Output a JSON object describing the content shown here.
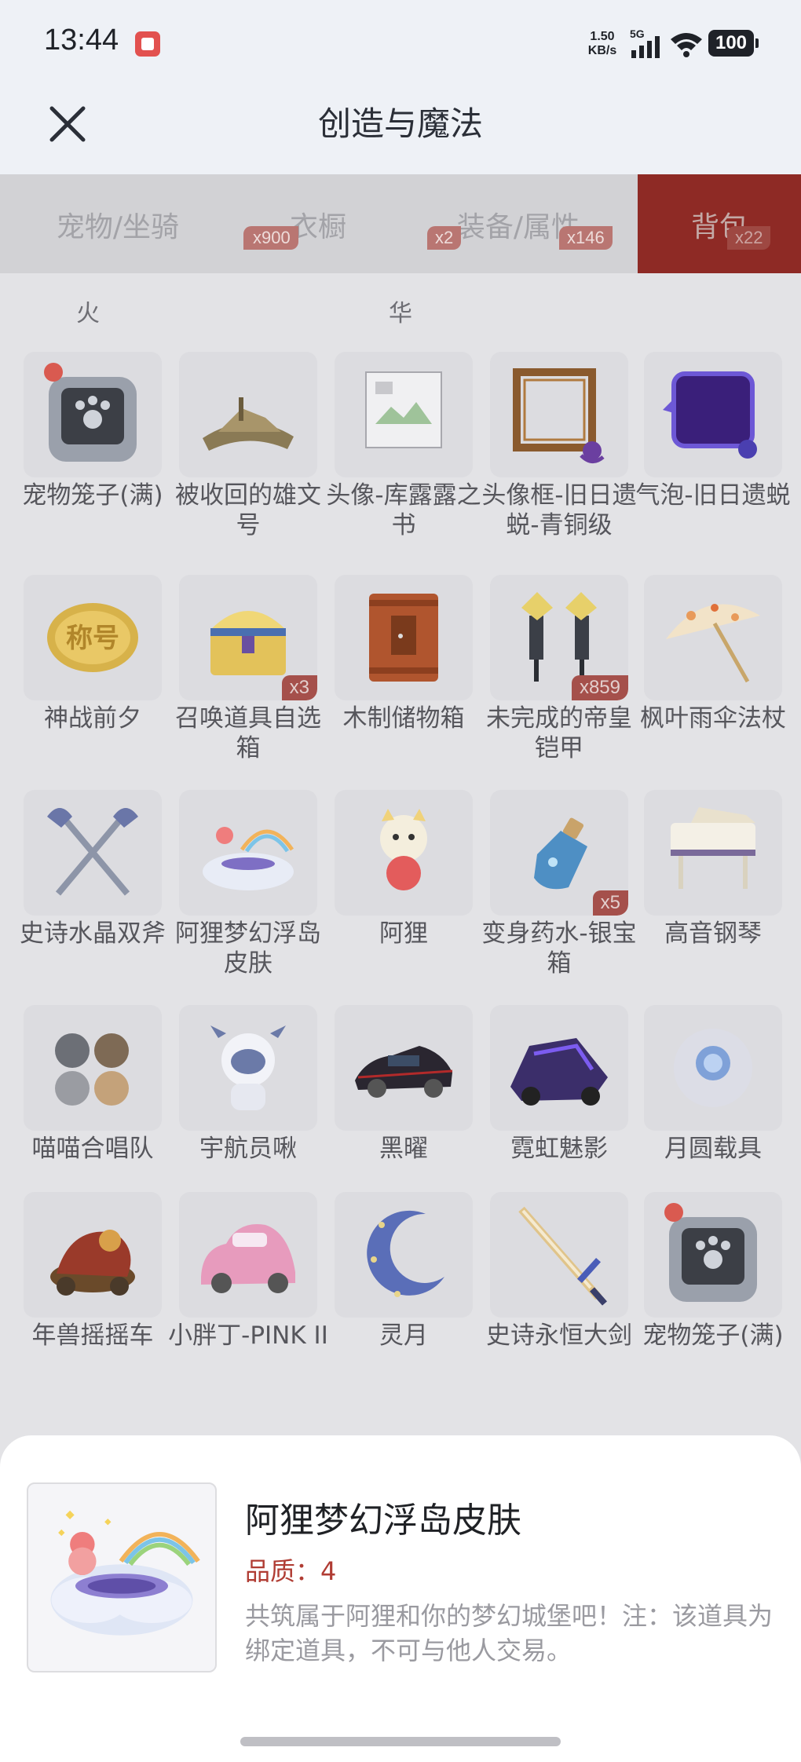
{
  "status": {
    "time": "13:44",
    "net_speed": "1.50 KB/s",
    "network": "5G",
    "battery": "100"
  },
  "header": {
    "title": "创造与魔法",
    "close_icon": "close-icon"
  },
  "tabs": [
    {
      "label": "宠物/坐骑",
      "count": "x900"
    },
    {
      "label": "衣橱",
      "count": "x2"
    },
    {
      "label": "装备/属性",
      "count": "x146"
    },
    {
      "label": "背包",
      "count": "x22",
      "active": true
    }
  ],
  "partial_row": [
    "火",
    "华"
  ],
  "items": [
    {
      "label": "宠物笼子(满)",
      "icon": "pet-cage-icon"
    },
    {
      "label": "被收回的雄文号",
      "icon": "wrecked-ship-icon"
    },
    {
      "label": "头像-库露露之书",
      "icon": "broken-image-icon"
    },
    {
      "label": "头像框-旧日遗蜕-青铜级",
      "icon": "avatar-frame-icon"
    },
    {
      "label": "气泡-旧日遗蜕",
      "icon": "chat-bubble-icon"
    },
    {
      "label": "神战前夕",
      "icon": "title-badge-icon"
    },
    {
      "label": "召唤道具自选箱",
      "icon": "treasure-chest-icon",
      "badge": "x3"
    },
    {
      "label": "木制储物箱",
      "icon": "wooden-crate-icon"
    },
    {
      "label": "未完成的帝皇铠甲",
      "icon": "armor-stand-icon",
      "badge": "x859"
    },
    {
      "label": "枫叶雨伞法杖",
      "icon": "umbrella-icon"
    },
    {
      "label": "史诗水晶双斧",
      "icon": "crossed-axes-icon"
    },
    {
      "label": "阿狸梦幻浮岛皮肤",
      "icon": "floating-island-icon"
    },
    {
      "label": "阿狸",
      "icon": "ali-fox-icon"
    },
    {
      "label": "变身药水-银宝箱",
      "icon": "potion-bottle-icon",
      "badge": "x5"
    },
    {
      "label": "高音钢琴",
      "icon": "piano-icon"
    },
    {
      "label": "喵喵合唱队",
      "icon": "cat-choir-icon"
    },
    {
      "label": "宇航员啾",
      "icon": "astronaut-icon"
    },
    {
      "label": "黑曜",
      "icon": "black-car-icon"
    },
    {
      "label": "霓虹魅影",
      "icon": "neon-car-icon"
    },
    {
      "label": "月圆载具",
      "icon": "moon-vehicle-icon"
    },
    {
      "label": "年兽摇摇车",
      "icon": "nian-ride-icon"
    },
    {
      "label": "小胖丁-PINK II",
      "icon": "pink-car-icon"
    },
    {
      "label": "灵月",
      "icon": "crescent-moon-icon"
    },
    {
      "label": "史诗永恒大剑",
      "icon": "great-sword-icon"
    },
    {
      "label": "宠物笼子(满)",
      "icon": "pet-cage-icon"
    }
  ],
  "detail": {
    "name": "阿狸梦幻浮岛皮肤",
    "quality": "品质：4",
    "description": "共筑属于阿狸和你的梦幻城堡吧！注：该道具为绑定道具，不可与他人交易。",
    "icon": "floating-island-icon"
  },
  "colors": {
    "accent": "#8e2a25",
    "quality": "#b03c33"
  }
}
